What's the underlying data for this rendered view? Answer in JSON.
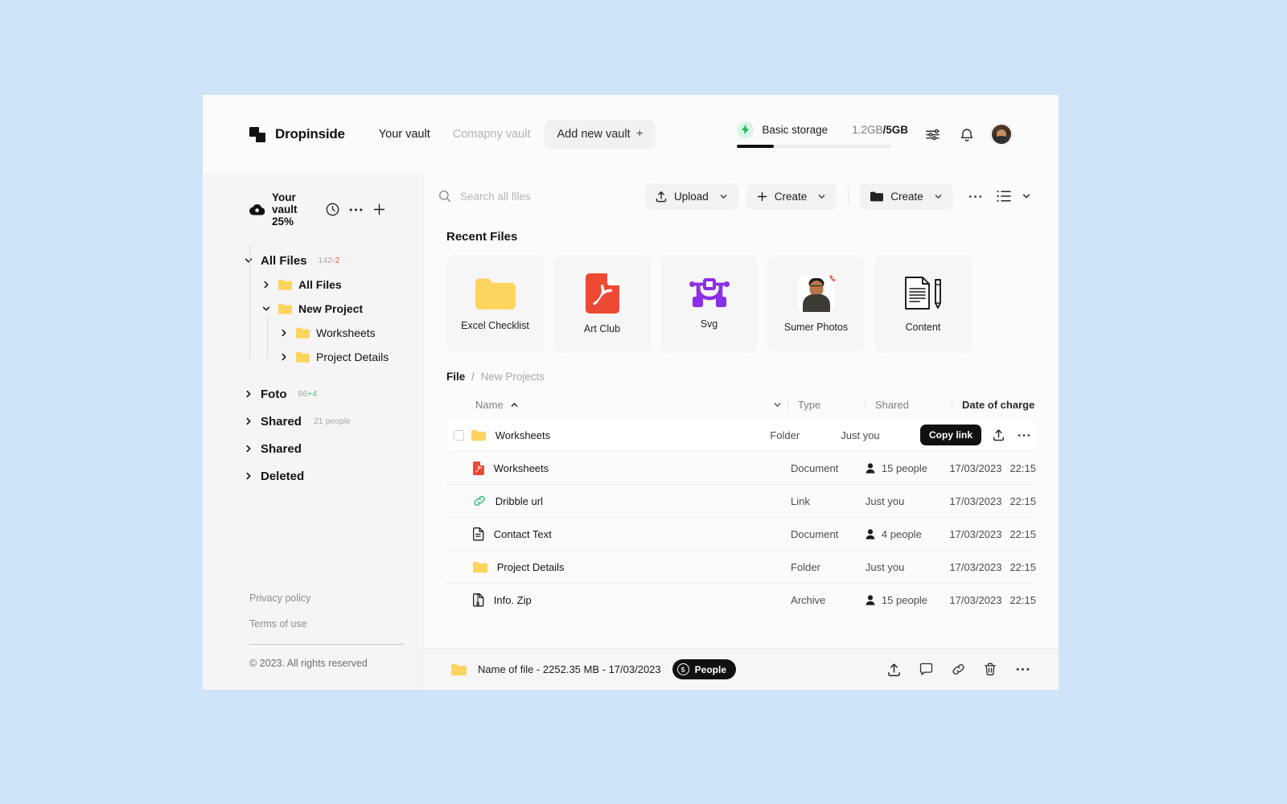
{
  "header": {
    "brand": "Dropinside",
    "logo_icon": "two-squares-logo",
    "tabs": [
      {
        "label": "Your vault",
        "state": "active"
      },
      {
        "label": "Comapny vault",
        "state": "muted"
      }
    ],
    "add_vault_label": "Add new vault",
    "add_vault_icon": "plus-icon",
    "storage": {
      "bolt_icon": "lightning-bolt-icon",
      "plan_label": "Basic storage",
      "used": "1.2GB",
      "separator": "/",
      "total": "5GB",
      "percent_filled": 24,
      "accent": "#17b85a"
    },
    "settings_icon": "sliders-icon",
    "notifications_icon": "bell-icon",
    "avatar_name": "user-avatar"
  },
  "sidebar": {
    "vault_title": "Your vault 25%",
    "vault_icon": "cloud-icon",
    "history_icon": "clock-icon",
    "more_icon": "ellipsis-icon",
    "add_icon": "plus-icon",
    "tree": [
      {
        "label": "All Files",
        "level": 0,
        "chevron": "down",
        "folder": false,
        "count": "142",
        "delta": "-2",
        "delta_type": "neg"
      },
      {
        "label": "All Files",
        "level": 1,
        "chevron": "right",
        "folder": true
      },
      {
        "label": "New Project",
        "level": 1,
        "chevron": "down",
        "folder": true
      },
      {
        "label": "Worksheets",
        "level": 2,
        "chevron": "right",
        "folder": true
      },
      {
        "label": "Project Details",
        "level": 2,
        "chevron": "right",
        "folder": true
      }
    ],
    "groups": [
      {
        "label": "Foto",
        "chevron": "right",
        "count": "86",
        "delta": "+4",
        "delta_type": "pos"
      },
      {
        "label": "Shared",
        "chevron": "right",
        "people": "21 people"
      },
      {
        "label": "Shared",
        "chevron": "right"
      },
      {
        "label": "Deleted",
        "chevron": "right"
      }
    ],
    "footer": {
      "privacy": "Privacy policy",
      "terms": "Terms of use",
      "copyright": "© 2023. All rights reserved"
    }
  },
  "toolbar": {
    "search_icon": "search-icon",
    "search_placeholder": "Search all files",
    "search_value": "",
    "upload_label": "Upload",
    "upload_icon": "upload-icon",
    "create_label": "Create",
    "create_icon": "plus-icon",
    "folder_create_label": "Create",
    "folder_create_icon": "folder-filled-icon",
    "caret_icon": "chevron-down-icon",
    "more_icon": "ellipsis-icon",
    "view_icon": "list-view-icon",
    "view_caret_icon": "chevron-down-icon"
  },
  "recent": {
    "title": "Recent Files",
    "cards": [
      {
        "label": "Excel Checklist",
        "icon": "folder-yellow-icon",
        "badge": null
      },
      {
        "label": "Art Club",
        "icon": "pdf-file-icon",
        "badge": null
      },
      {
        "label": "Svg",
        "icon": "vector-pen-icon",
        "badge": null
      },
      {
        "label": "Sumer Photos",
        "icon": "photo-thumbnail",
        "badge": "12"
      },
      {
        "label": "Content",
        "icon": "document-pencil-icon",
        "badge": null
      }
    ]
  },
  "breadcrumb": {
    "current": "File",
    "separator": "/",
    "next": "New Projects"
  },
  "table": {
    "columns": {
      "name": "Name",
      "sort_icon": "chevron-up-icon",
      "caret_icon": "chevron-down-icon",
      "type": "Type",
      "shared": "Shared",
      "date": "Date of charge"
    },
    "rows": [
      {
        "name": "Worksheets",
        "icon": "folder-yellow-icon",
        "type": "Folder",
        "shared": "Just you",
        "shared_icon": null,
        "date": "",
        "time": "",
        "hovered": true,
        "checkbox": true,
        "actions": {
          "copy_link": "Copy link",
          "share_icon": "upload-icon",
          "more_icon": "ellipsis-icon"
        }
      },
      {
        "name": "Worksheets",
        "icon": "pdf-file-icon",
        "type": "Document",
        "shared": "15 people",
        "shared_icon": "person-icon",
        "date": "17/03/2023",
        "time": "22:15",
        "hovered": false,
        "checkbox": false
      },
      {
        "name": "Dribble url",
        "icon": "link-green-icon",
        "type": "Link",
        "shared": "Just you",
        "shared_icon": null,
        "date": "17/03/2023",
        "time": "22:15",
        "hovered": false,
        "checkbox": false
      },
      {
        "name": "Contact Text",
        "icon": "text-document-icon",
        "type": "Document",
        "shared": "4 people",
        "shared_icon": "person-icon",
        "date": "17/03/2023",
        "time": "22:15",
        "hovered": false,
        "checkbox": false
      },
      {
        "name": "Project Details",
        "icon": "folder-yellow-icon",
        "type": "Folder",
        "shared": "Just you",
        "shared_icon": null,
        "date": "17/03/2023",
        "time": "22:15",
        "hovered": false,
        "checkbox": false
      },
      {
        "name": "Info. Zip",
        "icon": "archive-file-icon",
        "type": "Archive",
        "shared": "15 people",
        "shared_icon": "person-icon",
        "date": "17/03/2023",
        "time": "22:15",
        "hovered": false,
        "checkbox": false
      }
    ]
  },
  "bottom_bar": {
    "file_icon": "folder-yellow-icon",
    "summary": "Name of file - 2252.35 MB - 17/03/2023",
    "people_count": "5",
    "people_label": "People",
    "actions": [
      {
        "icon": "upload-icon"
      },
      {
        "icon": "comment-icon"
      },
      {
        "icon": "link-icon"
      },
      {
        "icon": "trash-icon"
      },
      {
        "icon": "ellipsis-icon"
      }
    ]
  }
}
